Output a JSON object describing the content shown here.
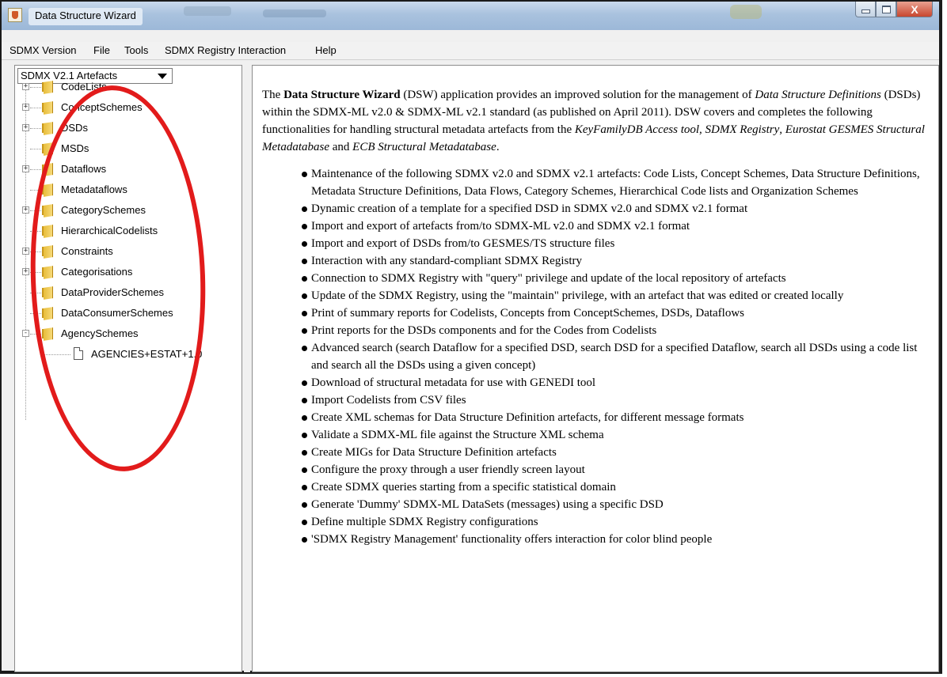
{
  "window": {
    "title": "Data Structure Wizard",
    "close_glyph": "X"
  },
  "menubar": {
    "items": [
      "SDMX Version",
      "File",
      "Tools",
      "SDMX Registry Interaction",
      "Help"
    ]
  },
  "left_panel": {
    "combo_value": "SDMX V2.1 Artefacts",
    "tree": [
      {
        "label": "CodeLists",
        "expander": "+"
      },
      {
        "label": "ConceptSchemes",
        "expander": "+"
      },
      {
        "label": "DSDs",
        "expander": "+"
      },
      {
        "label": "MSDs",
        "expander": ""
      },
      {
        "label": "Dataflows",
        "expander": "+"
      },
      {
        "label": "Metadataflows",
        "expander": ""
      },
      {
        "label": "CategorySchemes",
        "expander": "+"
      },
      {
        "label": "HierarchicalCodelists",
        "expander": ""
      },
      {
        "label": "Constraints",
        "expander": "+"
      },
      {
        "label": "Categorisations",
        "expander": "+"
      },
      {
        "label": "DataProviderSchemes",
        "expander": ""
      },
      {
        "label": "DataConsumerSchemes",
        "expander": ""
      },
      {
        "label": "AgencySchemes",
        "expander": "-"
      }
    ],
    "child": "AGENCIES+ESTAT+1.0"
  },
  "content": {
    "intro": {
      "p1": "The ",
      "b1": "Data Structure Wizard",
      "p2": " (DSW) application provides an improved solution for the management of ",
      "i1": "Data Structure Definitions",
      "p3": " (DSDs) within the SDMX-ML v2.0 & SDMX-ML v2.1 standard (as published on April 2011). DSW covers and completes the following functionalities for handling structural metadata artefacts from the ",
      "i2": "KeyFamilyDB Access tool",
      "p4": ", ",
      "i3": "SDMX Registry",
      "p5": ", ",
      "i4": "Eurostat GESMES Structural Metadatabase",
      "p6": " and ",
      "i5": "ECB Structural Metadatabase",
      "p7": "."
    },
    "features": [
      "Maintenance of the following SDMX v2.0 and SDMX v2.1 artefacts: Code Lists, Concept Schemes, Data Structure Definitions, Metadata Structure Definitions, Data Flows, Category Schemes, Hierarchical Code lists and Organization Schemes",
      "Dynamic creation of a template for a specified DSD in SDMX v2.0 and SDMX v2.1 format",
      "Import and export of artefacts from/to SDMX-ML v2.0 and SDMX v2.1 format",
      "Import and export of DSDs from/to GESMES/TS structure files",
      "Interaction with any standard-compliant SDMX Registry",
      "Connection to SDMX Registry with \"query\" privilege and update of the local repository of artefacts",
      "Update of the SDMX Registry, using the \"maintain\" privilege, with an artefact that was edited or created locally",
      "Print of summary reports for Codelists, Concepts from ConceptSchemes, DSDs, Dataflows",
      "Print reports for the DSDs components and for the Codes from Codelists",
      "Advanced search (search Dataflow for a specified DSD, search DSD for a specified Dataflow, search all DSDs using a code list and search all the DSDs using a given concept)",
      "Download of structural metadata for use with GENEDI tool",
      "Import Codelists from CSV files",
      "Create XML schemas for Data Structure Definition artefacts, for different message formats",
      "Validate a SDMX-ML file against the Structure XML schema",
      "Create MIGs for Data Structure Definition artefacts",
      "Configure the proxy through a user friendly screen layout",
      "Create SDMX queries starting from a specific statistical domain",
      "Generate 'Dummy' SDMX-ML DataSets (messages) using a specific DSD",
      "Define multiple SDMX Registry configurations",
      "'SDMX Registry Management' functionality offers interaction for color blind people"
    ]
  }
}
